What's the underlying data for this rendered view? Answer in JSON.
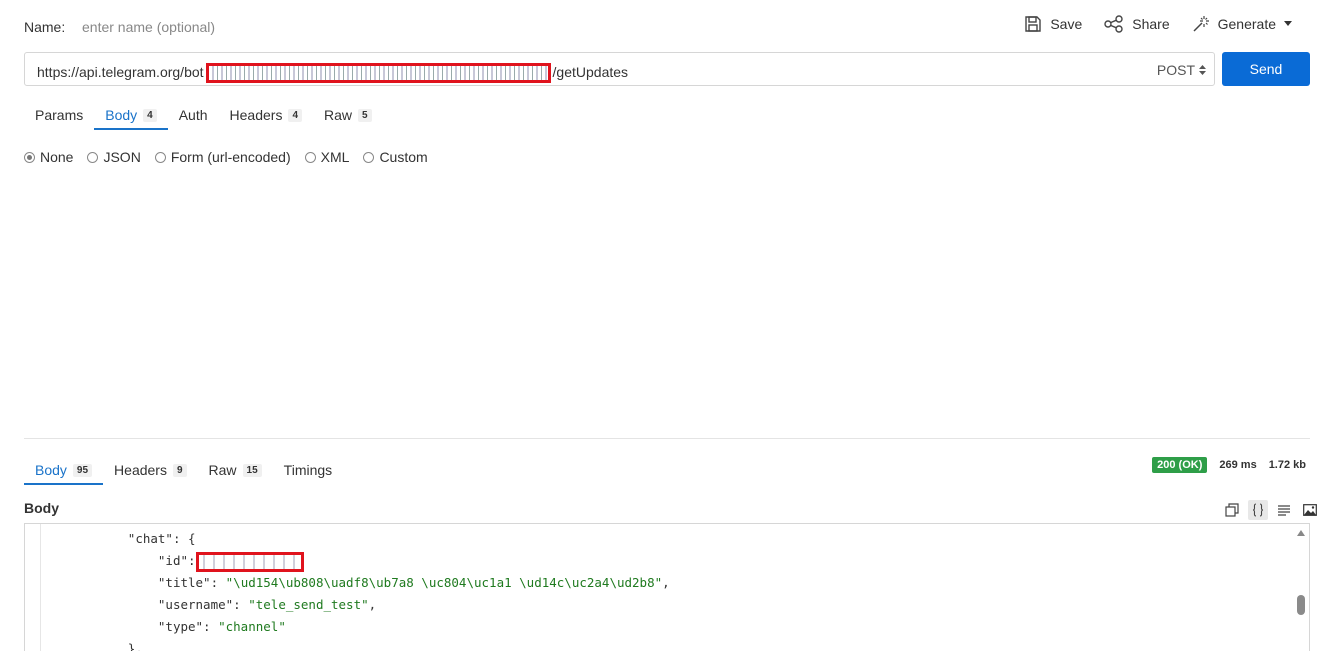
{
  "header": {
    "name_label": "Name:",
    "name_placeholder": "enter name (optional)",
    "save_label": "Save",
    "share_label": "Share",
    "generate_label": "Generate"
  },
  "request": {
    "url_prefix": "https://api.telegram.org/bot",
    "url_suffix": "/getUpdates",
    "method": "POST",
    "send_label": "Send",
    "tabs": [
      {
        "label": "Params",
        "count": ""
      },
      {
        "label": "Body",
        "count": "4"
      },
      {
        "label": "Auth",
        "count": ""
      },
      {
        "label": "Headers",
        "count": "4"
      },
      {
        "label": "Raw",
        "count": "5"
      }
    ],
    "body_types": [
      "None",
      "JSON",
      "Form (url-encoded)",
      "XML",
      "Custom"
    ],
    "selected_body_type": "None"
  },
  "response": {
    "tabs": [
      {
        "label": "Body",
        "count": "95"
      },
      {
        "label": "Headers",
        "count": "9"
      },
      {
        "label": "Raw",
        "count": "15"
      },
      {
        "label": "Timings",
        "count": ""
      }
    ],
    "status": "200 (OK)",
    "time": "269 ms",
    "size": "1.72 kb",
    "body_label": "Body",
    "code": {
      "chat_key": "\"chat\"",
      "id_key": "\"id\"",
      "title_key": "\"title\"",
      "title_value": "\"\\ud154\\ub808\\uadf8\\ub7a8 \\uc804\\uc1a1 \\ud14c\\uc2a4\\ud2b8\"",
      "username_key": "\"username\"",
      "username_value": "\"tele_send_test\"",
      "type_key": "\"type\"",
      "type_value": "\"channel\""
    }
  },
  "colors": {
    "accent": "#1a73c9",
    "send_button": "#0a6bd6",
    "status_ok": "#2e9e48",
    "redaction": "#e0131d",
    "string": "#1f7a1f"
  }
}
